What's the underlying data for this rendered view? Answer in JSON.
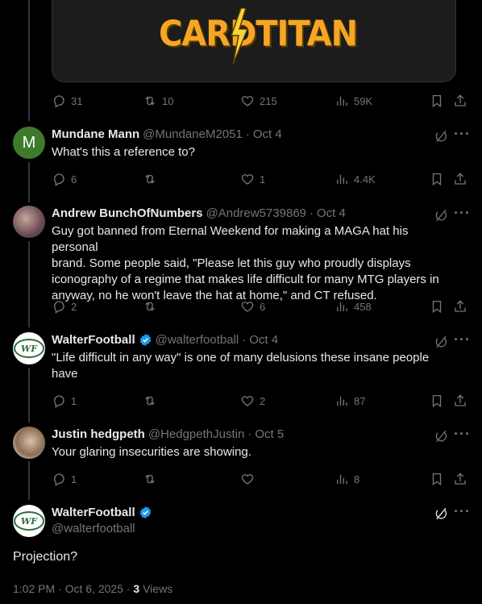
{
  "media": {
    "logo_text": "CARDTITAN"
  },
  "tweets": [
    {
      "name": "",
      "handle": "",
      "date": "",
      "replies": "31",
      "reposts": "10",
      "likes": "215",
      "views": "59K"
    },
    {
      "name": "Mundane Mann",
      "handle": "@MundaneM2051",
      "date": "Oct 4",
      "avatar_letter": "M",
      "text": "What's this a reference to?",
      "replies": "6",
      "reposts": "",
      "likes": "1",
      "views": "4.4K"
    },
    {
      "name": "Andrew BunchOfNumbers",
      "handle": "@Andrew5739869",
      "date": "Oct 4",
      "text_lines": [
        "Guy got banned from Eternal Weekend for making a MAGA hat his personal",
        "brand. Some people said, \"Please let this guy who proudly displays",
        "iconography of a regime that makes life difficult for many MTG players in",
        "anyway, no he won't leave the hat at home,\" and CT refused."
      ],
      "replies": "2",
      "reposts": "",
      "likes": "6",
      "views": "458"
    },
    {
      "name": "WalterFootball",
      "handle": "@walterfootball",
      "date": "Oct 4",
      "avatar_text": "WF",
      "text_lines": [
        "\"Life difficult in any way\" is one of many delusions these insane people",
        "have"
      ],
      "replies": "1",
      "reposts": "",
      "likes": "2",
      "views": "87"
    },
    {
      "name": "Justin hedgpeth",
      "handle": "@HedgpethJustin",
      "date": "Oct 5",
      "text": "Your glaring insecurities are showing.",
      "replies": "1",
      "reposts": "",
      "likes": "",
      "views": "8"
    }
  ],
  "main_tweet": {
    "name": "WalterFootball",
    "handle": "@walterfootball",
    "avatar_text": "WF",
    "text": "Projection?",
    "timestamp": "1:02 PM · Oct 6, 2025 · ",
    "views_count": "3",
    "views_label": "Views"
  },
  "icons": [
    "reply-icon",
    "repost-icon",
    "like-icon",
    "views-icon",
    "bookmark-icon",
    "share-icon",
    "grok-icon",
    "more-icon",
    "verified-badge-icon"
  ],
  "colors": {
    "background": "#000000",
    "text": "#e7e9ea",
    "muted": "#71767b",
    "verified": "#1d9bf0",
    "logo": "#f5a623"
  }
}
